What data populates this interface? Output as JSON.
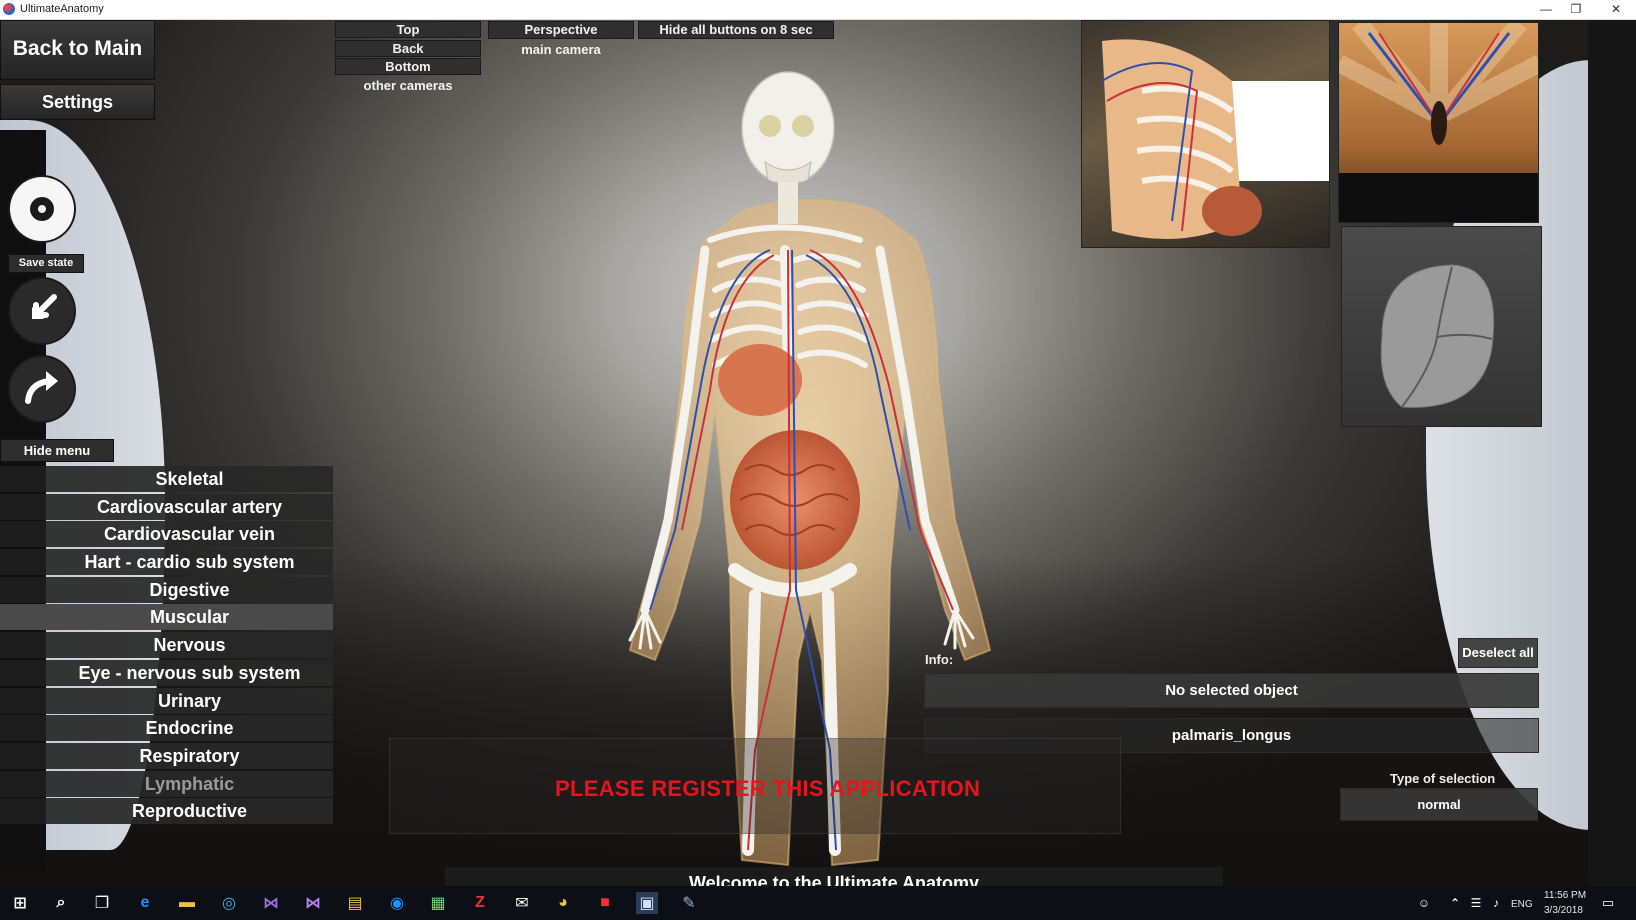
{
  "window": {
    "title": "UltimateAnatomy",
    "minimize": "—",
    "restore": "❐",
    "close": "✕"
  },
  "camera_views": {
    "top": "Top",
    "back": "Back",
    "bottom": "Bottom",
    "other_cameras": "other cameras",
    "perspective": "Perspective",
    "main_camera": "main camera",
    "hide_buttons": "Hide all buttons on 8 sec"
  },
  "nav": {
    "back_to_main": "Back to Main",
    "settings": "Settings"
  },
  "tools": {
    "save_state": "Save state",
    "hide_menu": "Hide menu"
  },
  "systems": [
    {
      "label": "Skeletal",
      "state": "normal"
    },
    {
      "label": "Cardiovascular artery",
      "state": "normal"
    },
    {
      "label": "Cardiovascular vein",
      "state": "normal"
    },
    {
      "label": "Hart - cardio sub system",
      "state": "normal"
    },
    {
      "label": "Digestive",
      "state": "normal"
    },
    {
      "label": "Muscular",
      "state": "active"
    },
    {
      "label": "Nervous",
      "state": "normal"
    },
    {
      "label": "Eye - nervous sub system",
      "state": "normal"
    },
    {
      "label": "Urinary",
      "state": "normal"
    },
    {
      "label": "Endocrine",
      "state": "normal"
    },
    {
      "label": "Respiratory",
      "state": "normal"
    },
    {
      "label": "Lymphatic",
      "state": "disabled"
    },
    {
      "label": "Reproductive",
      "state": "normal"
    }
  ],
  "info": {
    "label": "Info:",
    "selected": "No selected object",
    "hovered": "palmaris_longus",
    "deselect_all": "Deselect all",
    "selection_type_label": "Type of selection",
    "selection_type": "normal"
  },
  "register_notice": "PLEASE REGISTER THIS APPLICATION",
  "welcome": "Welcome to the Ultimate Anatomy",
  "taskbar": {
    "time": "11:56 PM",
    "date": "3/3/2018",
    "lang": "ENG"
  },
  "colors": {
    "register_red": "#e8141c",
    "artery_red": "#c8303a",
    "vein_blue": "#2e4fb0",
    "bone": "#f2f0ea"
  }
}
